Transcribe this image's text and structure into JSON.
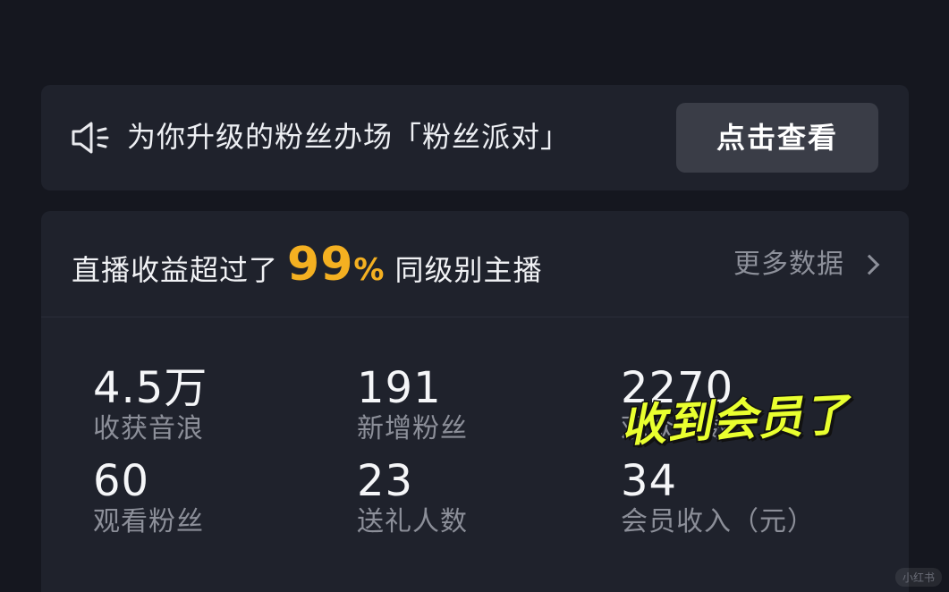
{
  "banner": {
    "icon": "speaker-icon",
    "text": "为你升级的粉丝办场「粉丝派对」",
    "button_label": "点击查看"
  },
  "headline": {
    "prefix": "直播收益超过了",
    "percent_value": "99",
    "percent_sign": "%",
    "suffix": "同级别主播",
    "more_label": "更多数据"
  },
  "stats": [
    {
      "value": "4.5万",
      "label": "收获音浪"
    },
    {
      "value": "191",
      "label": "新增粉丝"
    },
    {
      "value": "2270",
      "label": "观众人数"
    },
    {
      "value": "60",
      "label": "观看粉丝"
    },
    {
      "value": "23",
      "label": "送礼人数"
    },
    {
      "value": "34",
      "label": "会员收入（元）"
    }
  ],
  "overlay": {
    "sticker_text": "收到会员了"
  },
  "watermark": "小红书",
  "colors": {
    "accent": "#f4b021",
    "sticker": "#e9ff2f",
    "background": "#15171f",
    "card": "#1f222c"
  }
}
